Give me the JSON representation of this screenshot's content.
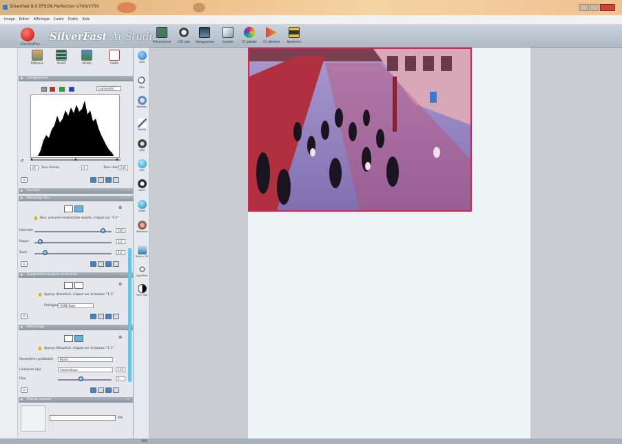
{
  "window": {
    "title": "SilverFast 8.0 EPSON Perfection V700/V750"
  },
  "menu": [
    "Image",
    "Editer",
    "Affichage",
    "Cadre",
    "Outils",
    "Aide"
  ],
  "app": {
    "logo_label": "SilverFastPlus",
    "brand": "SilverFast",
    "brand_suffix": "Ai Studio"
  },
  "toolbar": [
    {
      "label": "Prénumériser",
      "icon": "prescan-icon",
      "color": "#4a7a5a"
    },
    {
      "label": "CCR auto",
      "icon": "auto-adjust-icon",
      "color": "#555"
    },
    {
      "label": "Histogramme",
      "icon": "histogram-icon",
      "color": "#3a6080"
    },
    {
      "label": "Courbes",
      "icon": "curves-icon",
      "color": "#6a7a8a"
    },
    {
      "label": "CC globale",
      "icon": "global-color-icon",
      "color": "#d04080"
    },
    {
      "label": "CC sélective",
      "icon": "selective-color-icon",
      "color": "#e05050"
    },
    {
      "label": "Numériser",
      "icon": "scan-icon",
      "color": "#4a4020"
    }
  ],
  "modes": [
    {
      "label": "Réflexion",
      "icon": "reflective-icon"
    },
    {
      "label": "Positif",
      "icon": "positive-film-icon"
    },
    {
      "label": "48 bits",
      "icon": "48bit-icon"
    },
    {
      "label": "Cadre",
      "icon": "frame-icon"
    }
  ],
  "histogram": {
    "title": "Histogramme",
    "dropdown": "Luminosité",
    "shadow_value": "65",
    "shadow_label": "Tons foncés",
    "mid_value": "0",
    "highlight_label": "Tons clairs",
    "highlight_value": "236",
    "colors": [
      "#9a9a9a",
      "#e02020",
      "#20b020",
      "#2040e0"
    ]
  },
  "sections": {
    "curves": "Courbes",
    "usm": "Masquage flou",
    "gand": "Suppression du grain et du bruit",
    "dust": "Détramage",
    "scanner": "État du scanner"
  },
  "usm": {
    "hint": "Pour une pré-visualisation exacte, cliquez sur \"1:1\"",
    "intensity_label": "Intensité",
    "intensity_value": "100",
    "radius_label": "Rayon",
    "radius_value": "0,2",
    "threshold_label": "Seuil",
    "threshold_value": "2,0"
  },
  "gand": {
    "hint": "Aperçu désactivé, cliquez sur le bouton \"1:1\"",
    "preset_label": "Préréglage",
    "preset_value": "GANE léger"
  },
  "dust": {
    "hint": "Aperçu désactivé, cliquez sur le bouton \"1:1\"",
    "param_label": "Paramètres préétablis",
    "param_value": "Néant",
    "screen_label": "Linéature (lpi)",
    "screen_value": "Automatique",
    "screen_num": "133",
    "blur_label": "Flou",
    "blur_value": "5"
  },
  "scanner_state": {
    "progress_percent": 0,
    "progress_label": "0%"
  },
  "vtools": [
    {
      "label": "Infos",
      "icon": "info-icon",
      "color": "#3a90d0"
    },
    {
      "label": "DPIs",
      "icon": "magnifier-icon",
      "color": "#5a6a7a"
    },
    {
      "label": "Rotation",
      "icon": "rotation-icon",
      "color": "#5a8ac0"
    },
    {
      "label": "Pipette",
      "icon": "eyedropper-icon",
      "color": "#5a6a7a"
    },
    {
      "label": "USM",
      "icon": "usm-icon",
      "color": "#555"
    },
    {
      "label": "SRD",
      "icon": "srd-icon",
      "color": "#2aa0d0"
    },
    {
      "label": "AACO",
      "icon": "aaco-icon",
      "color": "#444"
    },
    {
      "label": "GANE",
      "icon": "gane-icon",
      "color": "#2a90c0"
    },
    {
      "label": "Détramer",
      "icon": "descreen-icon",
      "color": "#a06050"
    },
    {
      "label": "Batch / FB",
      "icon": "batch-icon",
      "color": "#2a80a0"
    },
    {
      "label": "ScanPilot",
      "icon": "scanpilot-icon",
      "color": "#666"
    },
    {
      "label": "Print Tips",
      "icon": "printtips-icon",
      "color": "#333"
    }
  ],
  "status": {
    "zoom": "49%"
  }
}
